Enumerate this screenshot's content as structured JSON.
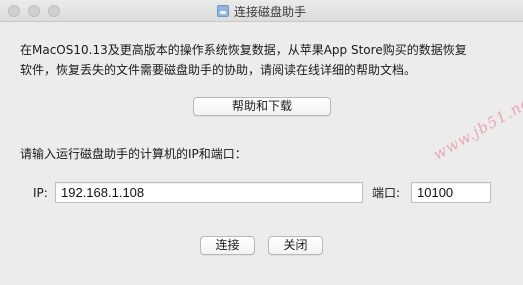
{
  "window": {
    "title": "连接磁盘助手",
    "title_icon": "disk-utility-icon"
  },
  "intro": {
    "text": "在MacOS10.13及更高版本的操作系统恢复数据，从苹果App Store购买的数据恢复\n软件，恢复丢失的文件需要磁盘助手的协助，请阅读在线详细的帮助文档。"
  },
  "buttons": {
    "help_label": "帮助和下载",
    "connect_label": "连接",
    "close_label": "关闭"
  },
  "form": {
    "prompt": "请输入运行磁盘助手的计算机的IP和端口：",
    "ip_label": "IP:",
    "ip_value": "192.168.1.108",
    "port_label": "端口:",
    "port_value": "10100"
  },
  "watermark": {
    "text": "www.jb51.net"
  }
}
